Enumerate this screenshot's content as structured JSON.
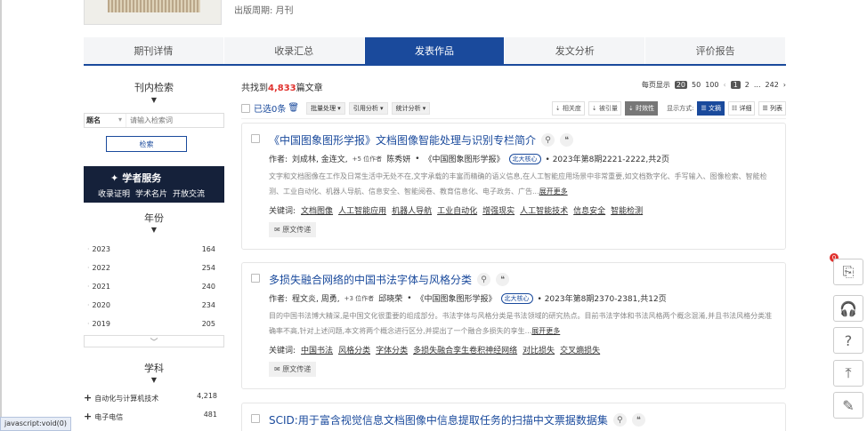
{
  "journal": {
    "publish_cycle": "出版周期: 月刊"
  },
  "tabs": [
    {
      "label": "期刊详情"
    },
    {
      "label": "收录汇总"
    },
    {
      "label": "发表作品"
    },
    {
      "label": "发文分析"
    },
    {
      "label": "评价报告"
    }
  ],
  "sidebar": {
    "search_title": "刊内检索",
    "search_field": "题名",
    "search_placeholder": "请输入检索词",
    "search_button": "检索",
    "scholar_title": "学者服务",
    "scholar_links": [
      "收录证明",
      "学术名片",
      "开放交流"
    ],
    "year_title": "年份",
    "years": [
      {
        "year": "2023",
        "count": "164"
      },
      {
        "year": "2022",
        "count": "254"
      },
      {
        "year": "2021",
        "count": "240"
      },
      {
        "year": "2020",
        "count": "234"
      },
      {
        "year": "2019",
        "count": "205"
      }
    ],
    "subject_title": "学科",
    "subjects": [
      {
        "name": "自动化与计算机技术",
        "count": "4,218"
      },
      {
        "name": "电子电信",
        "count": "481"
      }
    ]
  },
  "results": {
    "found_prefix": "共找到",
    "found_count": "4,833",
    "found_suffix": "篇文章",
    "per_page_label": "每页显示",
    "per_page_options": [
      "20",
      "50",
      "100"
    ],
    "pages": [
      "1",
      "2",
      "...",
      "242"
    ],
    "select_label": "已选0条",
    "dropdowns": [
      "批量处理",
      "引用分析",
      "统计分析"
    ],
    "sort_buttons": [
      "相关度",
      "被引量",
      "时效性"
    ],
    "view_label": "显示方式:",
    "view_buttons": [
      "文摘",
      "详细",
      "列表"
    ]
  },
  "articles": [
    {
      "title": "《中国图象图形学报》文档图像智能处理与识别专栏简介",
      "authors_label": "作者:",
      "authors": "刘成林, 金连文,",
      "more_authors": "+5 位作者",
      "last_author": "陈秀妍",
      "journal": "《中国图象图形学报》",
      "badge": "北大核心",
      "issue": "• 2023年第8期2221-2222,共2页",
      "abstract": "文字和文档图像在工作及日常生活中无处不在,文字承载的丰富而精确的语义信息,在人工智能应用场景中非常重要,如文档数字化、手写输入、图像检索、智能检测、工业自动化、机器人导航、信息安全、智能阅卷、教育信息化、电子政务、广告...",
      "expand": "展开更多",
      "kw_label": "关键词:",
      "keywords": [
        "文档图像",
        "人工智能应用",
        "机器人导航",
        "工业自动化",
        "增强现实",
        "人工智能技术",
        "信息安全",
        "智能检测"
      ],
      "send": "原文传递"
    },
    {
      "title": "多损失融合网络的中国书法字体与风格分类",
      "authors_label": "作者:",
      "authors": "程文炎, 周勇,",
      "more_authors": "+3 位作者",
      "last_author": "邱晓荣",
      "journal": "《中国图象图形学报》",
      "badge": "北大核心",
      "issue": "• 2023年第8期2370-2381,共12页",
      "abstract": "目的中国书法博大精深,是中国文化很重要的组成部分。书法字体与风格分类是书法领域的研究热点。目前书法字体和书法风格两个概念混淆,并且书法风格分类准确率不高,针对上述问题,本文将两个概念进行区分,并提出了一个融合多损失的孪生...",
      "expand": "展开更多",
      "kw_label": "关键词:",
      "keywords": [
        "中国书法",
        "风格分类",
        "字体分类",
        "多损失融合孪生卷积神经网络",
        "对比损失",
        "交叉熵损失"
      ],
      "send": "原文传递"
    },
    {
      "title": "SCID:用于富含视觉信息文档图像中信息提取任务的扫描中文票据数据集"
    }
  ],
  "float_badge": "0",
  "statusbar": "javascript:void(0)"
}
